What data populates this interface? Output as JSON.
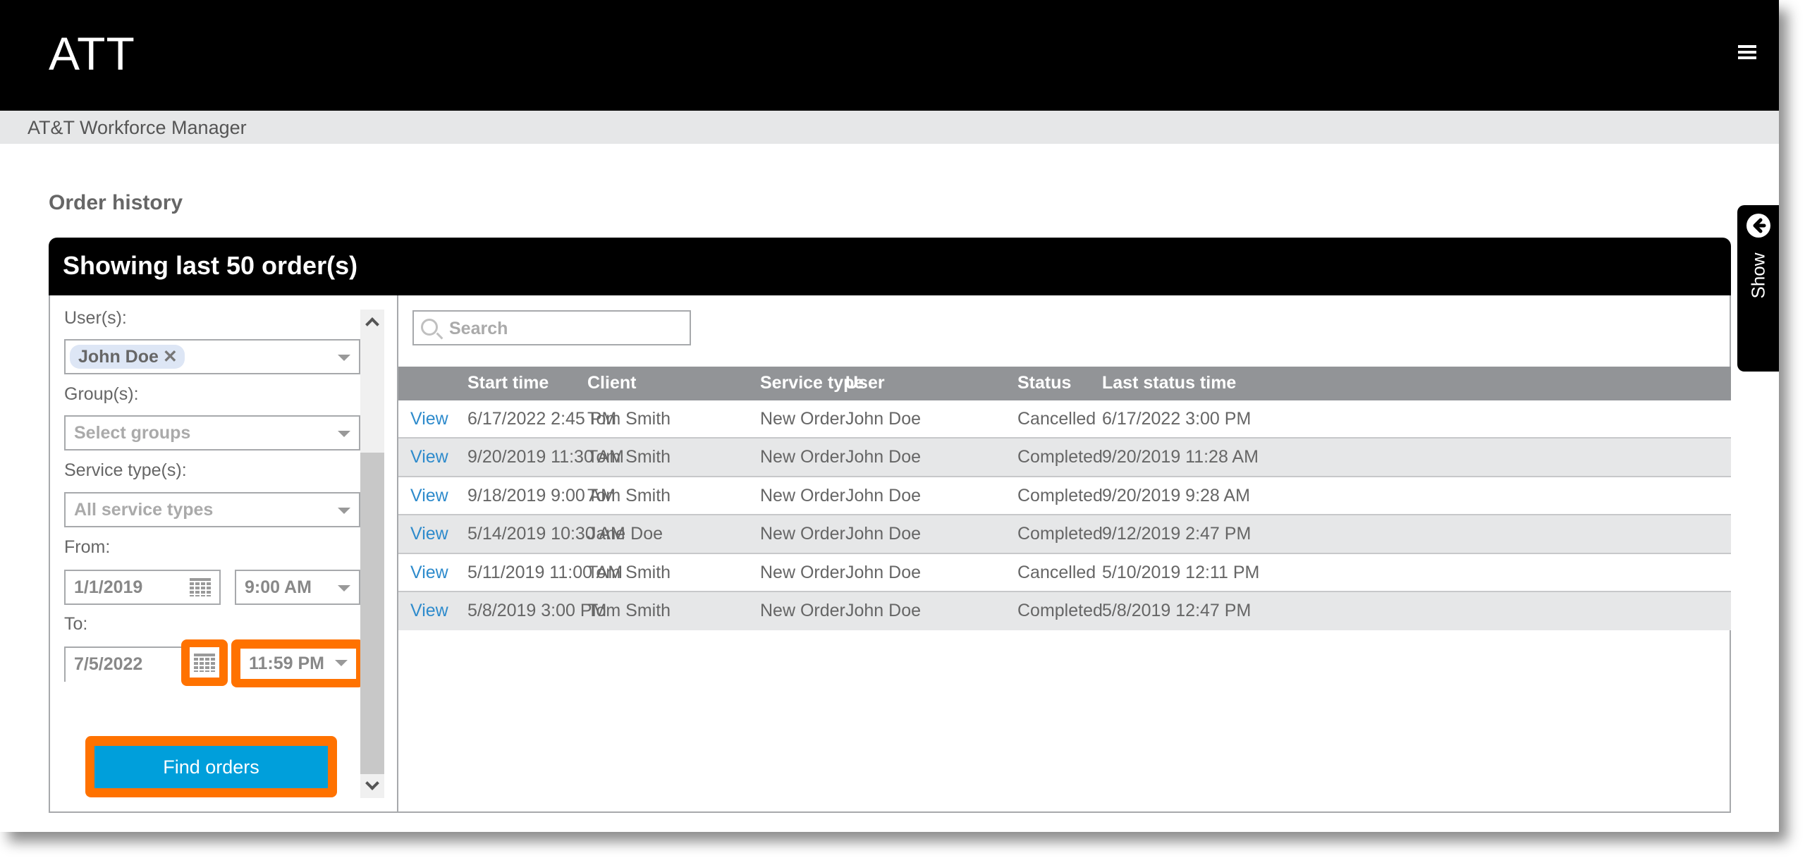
{
  "header": {
    "brand": "ATT",
    "menu_icon": "hamburger-menu-icon"
  },
  "subheader": {
    "title": "AT&T Workforce Manager"
  },
  "page": {
    "title": "Order history"
  },
  "card": {
    "title": "Showing last 50 order(s)"
  },
  "filters": {
    "users_label": "User(s):",
    "users_selected": [
      {
        "label": "John Doe",
        "remove_icon": "close-icon"
      }
    ],
    "groups_label": "Group(s):",
    "groups_placeholder": "Select groups",
    "service_types_label": "Service type(s):",
    "service_types_placeholder": "All service types",
    "from_label": "From:",
    "from_date": "1/1/2019",
    "from_time": "9:00 AM",
    "to_label": "To:",
    "to_date": "7/5/2022",
    "to_time": "11:59 PM",
    "find_button": "Find orders",
    "highlight_color": "#FF7200",
    "button_color": "#009FDB"
  },
  "search": {
    "placeholder": "Search",
    "value": ""
  },
  "table": {
    "columns": [
      "",
      "Start time",
      "Client",
      "Service type",
      "User",
      "Status",
      "Last status time"
    ],
    "rows": [
      {
        "action": "View",
        "start_time": "6/17/2022 2:45 PM",
        "client": "Tom Smith",
        "service_type": "New Order",
        "user": "John Doe",
        "status": "Cancelled",
        "last_status_time": "6/17/2022 3:00 PM"
      },
      {
        "action": "View",
        "start_time": "9/20/2019 11:30 AM",
        "client": "Tom Smith",
        "service_type": "New Order",
        "user": "John Doe",
        "status": "Completed",
        "last_status_time": "9/20/2019 11:28 AM"
      },
      {
        "action": "View",
        "start_time": "9/18/2019 9:00 AM",
        "client": "Tom Smith",
        "service_type": "New Order",
        "user": "John Doe",
        "status": "Completed",
        "last_status_time": "9/20/2019 9:28 AM"
      },
      {
        "action": "View",
        "start_time": "5/14/2019 10:30 AM",
        "client": "Jane Doe",
        "service_type": "New Order",
        "user": "John Doe",
        "status": "Completed",
        "last_status_time": "9/12/2019 2:47 PM"
      },
      {
        "action": "View",
        "start_time": "5/11/2019 11:00 AM",
        "client": "Tom Smith",
        "service_type": "New Order",
        "user": "John Doe",
        "status": "Cancelled",
        "last_status_time": "5/10/2019 12:11 PM"
      },
      {
        "action": "View",
        "start_time": "5/8/2019 3:00 PM",
        "client": "Tom Smith",
        "service_type": "New Order",
        "user": "John Doe",
        "status": "Completed",
        "last_status_time": "5/8/2019 12:47 PM"
      }
    ]
  },
  "side_tab": {
    "label": "Show",
    "icon": "arrow-left-circle-icon"
  }
}
